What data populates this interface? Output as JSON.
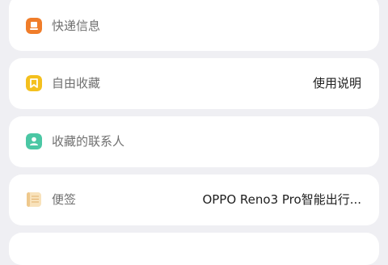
{
  "list": {
    "items": [
      {
        "label": "快递信息",
        "value": "",
        "icon": "package-icon",
        "icon_color": "#f07d2a"
      },
      {
        "label": "自由收藏",
        "value": "使用说明",
        "icon": "bookmark-icon",
        "icon_color": "#f4c01e"
      },
      {
        "label": "收藏的联系人",
        "value": "",
        "icon": "contact-icon",
        "icon_color": "#4bc7a4"
      },
      {
        "label": "便签",
        "value": "OPPO Reno3 Pro智能出行...",
        "icon": "notepad-icon",
        "icon_color": "#f8e2bb"
      }
    ]
  },
  "colors": {
    "background": "#efeff3",
    "card": "#ffffff",
    "label_text": "#707070",
    "value_text": "#1e1e1e"
  }
}
